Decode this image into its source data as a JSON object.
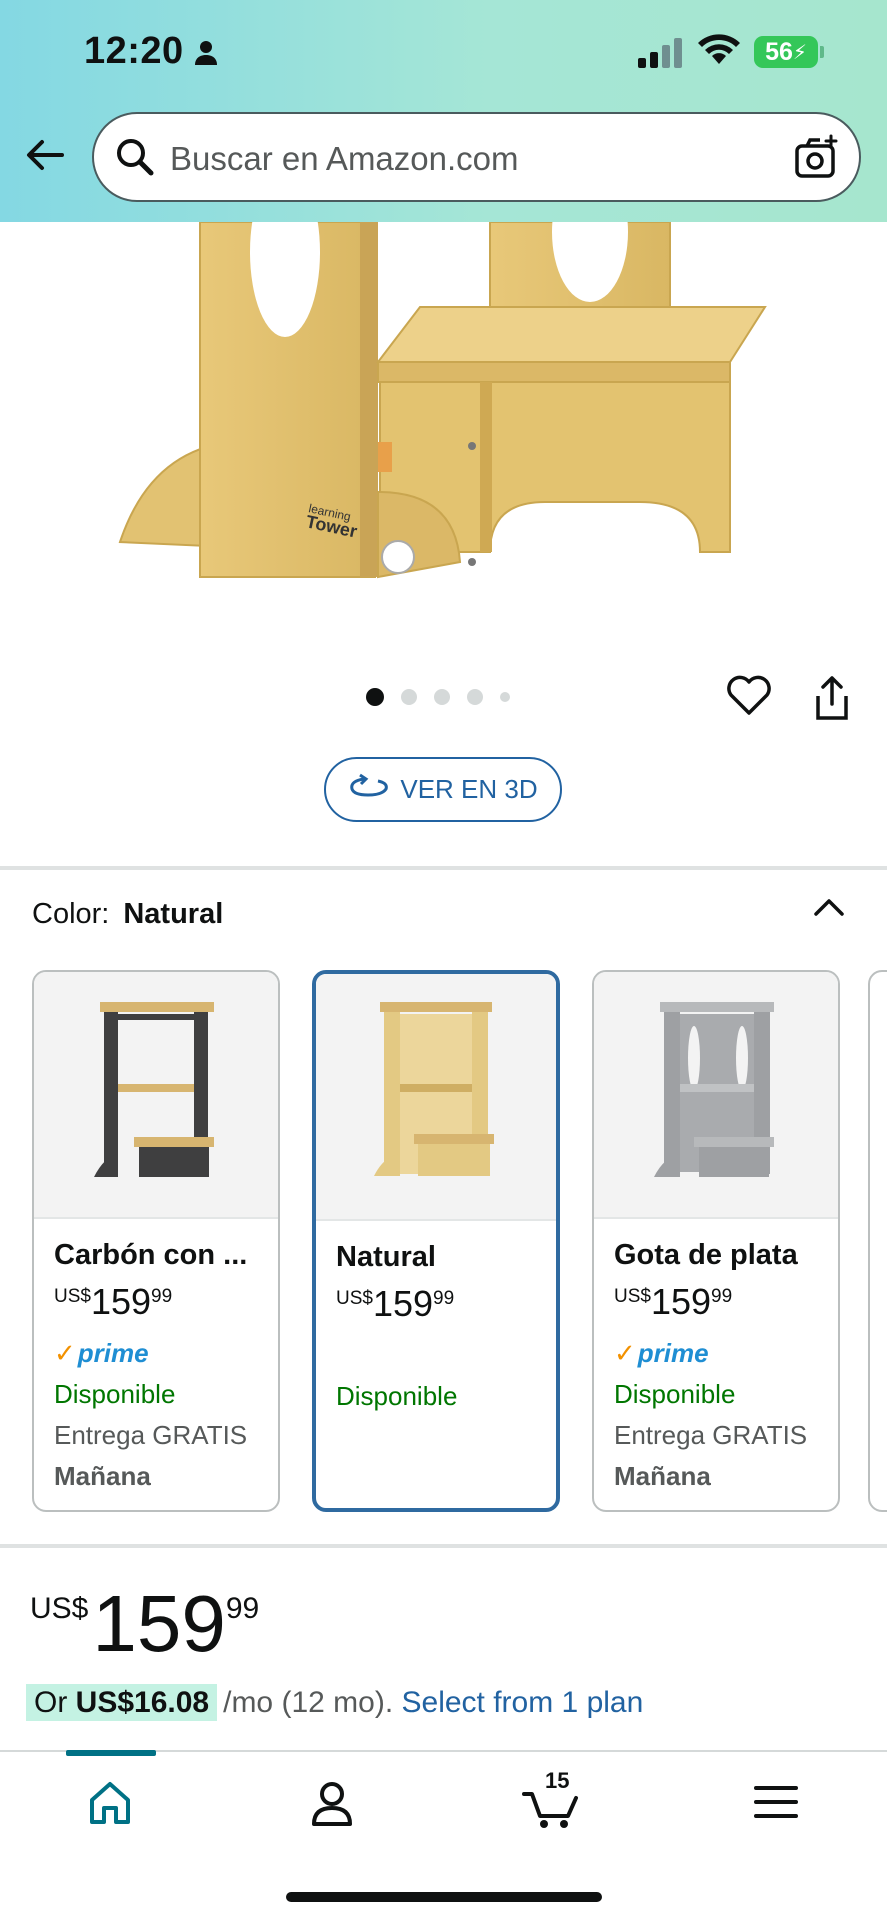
{
  "status_bar": {
    "time": "12:20",
    "battery": "56"
  },
  "search": {
    "placeholder": "Buscar en Amazon.com"
  },
  "product_image": {
    "brand_mark": "Learning Tower",
    "carousel_index": 1,
    "carousel_count": 5
  },
  "view_3d": {
    "label": "VER EN 3D"
  },
  "color": {
    "label": "Color:",
    "value": "Natural"
  },
  "variants": [
    {
      "name": "Carbón con ...",
      "currency": "US$",
      "whole": "159",
      "fraction": "99",
      "prime": "prime",
      "availability": "Disponible",
      "delivery": "Entrega GRATIS",
      "day": "Mañana",
      "color": "#3f3f40"
    },
    {
      "name": "Natural",
      "currency": "US$",
      "whole": "159",
      "fraction": "99",
      "prime": "",
      "availability": "Disponible",
      "delivery": "",
      "day": "",
      "color": "#e3c983"
    },
    {
      "name": "Gota de plata",
      "currency": "US$",
      "whole": "159",
      "fraction": "99",
      "prime": "prime",
      "availability": "Disponible",
      "delivery": "Entrega GRATIS",
      "day": "Mañana",
      "color": "#9ea0a3"
    }
  ],
  "price": {
    "currency": "US$",
    "whole": "159",
    "fraction": "99"
  },
  "installment": {
    "prefix": "Or",
    "amount": "US$16.08",
    "term": "/mo (12 mo).",
    "link": "Select from 1 plan"
  },
  "tabbar": {
    "cart_count": "15"
  },
  "colors": {
    "accent": "#007185",
    "link": "#2162a1",
    "available": "#007600",
    "prime_blue": "#1f8ed3"
  }
}
